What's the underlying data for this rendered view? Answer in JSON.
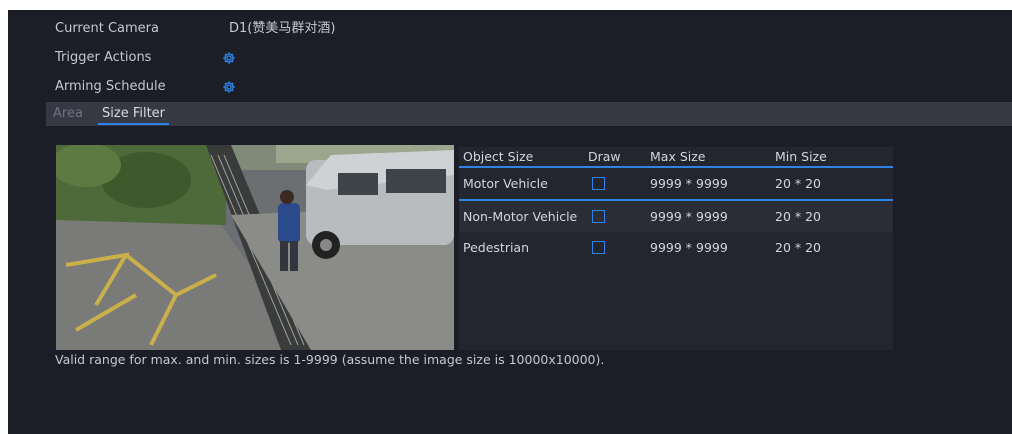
{
  "fields": {
    "current_camera_label": "Current Camera",
    "current_camera_value": "D1(赞美马群对酒)",
    "trigger_actions_label": "Trigger Actions",
    "arming_schedule_label": "Arming Schedule"
  },
  "tabs": [
    {
      "label": "Area",
      "active": false
    },
    {
      "label": "Size Filter",
      "active": true
    }
  ],
  "table": {
    "headers": [
      "Object Size",
      "Draw",
      "Max Size",
      "Min Size"
    ],
    "rows": [
      {
        "object": "Motor Vehicle",
        "max": "9999 * 9999",
        "min": "20 * 20",
        "selected": true
      },
      {
        "object": "Non-Motor Vehicle",
        "max": "9999 * 9999",
        "min": "20 * 20",
        "selected": false
      },
      {
        "object": "Pedestrian",
        "max": "9999 * 9999",
        "min": "20 * 20",
        "selected": false
      }
    ]
  },
  "note": "Valid range for max. and min. sizes is 1-9999 (assume the image size is 10000x10000).",
  "icons": {
    "trigger_actions": "gear-icon",
    "arming_schedule": "gear-icon",
    "draw": "edit-icon"
  },
  "colors": {
    "background": "#1b1e26",
    "tab_bar": "#363943",
    "accent": "#2e84e6",
    "text": "#c5c8cf"
  }
}
